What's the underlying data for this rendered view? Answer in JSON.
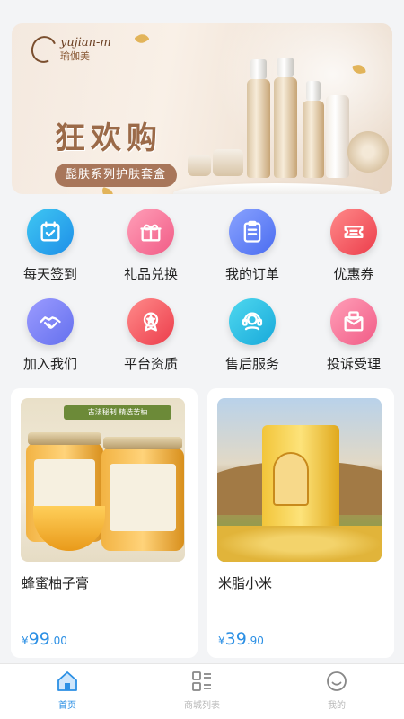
{
  "banner": {
    "brand_en": "yujian-m",
    "brand_cn": "瑜伽美",
    "headline": "狂欢购",
    "tagline": "髭肤系列护肤套盒"
  },
  "menu": {
    "items": [
      {
        "label": "每天签到",
        "icon": "calendar-check-icon",
        "color": "#1e8fe8"
      },
      {
        "label": "礼品兑换",
        "icon": "gift-icon",
        "color": "#f15b86"
      },
      {
        "label": "我的订单",
        "icon": "clipboard-list-icon",
        "color": "#4a6cf0"
      },
      {
        "label": "优惠券",
        "icon": "coupon-icon",
        "color": "#ec3d4b"
      },
      {
        "label": "加入我们",
        "icon": "handshake-icon",
        "color": "#6470ee"
      },
      {
        "label": "平台资质",
        "icon": "award-badge-icon",
        "color": "#ec3d4b"
      },
      {
        "label": "售后服务",
        "icon": "headset-agent-icon",
        "color": "#18a9da"
      },
      {
        "label": "投诉受理",
        "icon": "complaint-envelope-icon",
        "color": "#f15b86"
      }
    ]
  },
  "products": [
    {
      "title": "蜂蜜柚子膏",
      "currency": "¥",
      "price_int": "99",
      "price_dec": ".00",
      "image_text": "古法秘制 精选苦柚"
    },
    {
      "title": "米脂小米",
      "currency": "¥",
      "price_int": "39",
      "price_dec": ".90"
    }
  ],
  "tabbar": {
    "tabs": [
      {
        "label": "首页",
        "icon": "home-icon",
        "active": true
      },
      {
        "label": "商城列表",
        "icon": "grid-list-icon",
        "active": false
      },
      {
        "label": "我的",
        "icon": "smiley-user-icon",
        "active": false
      }
    ],
    "active_color": "#2b8fe4",
    "inactive_color": "#b7b7b7"
  }
}
